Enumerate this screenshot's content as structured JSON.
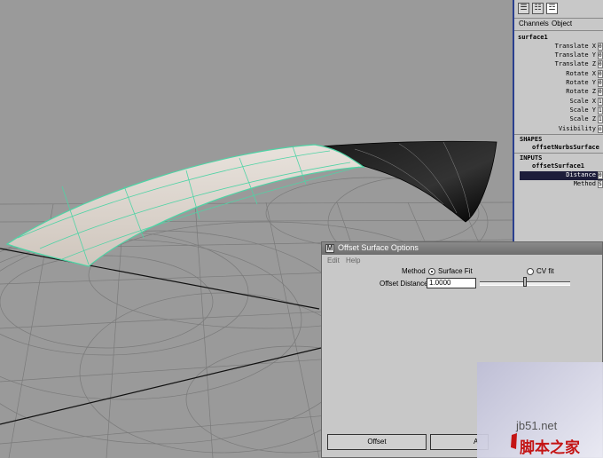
{
  "channel_box": {
    "tabs": [
      "Channels",
      "Object"
    ],
    "node_name": "surface1",
    "attributes": [
      {
        "name": "Translate X",
        "value": "0"
      },
      {
        "name": "Translate Y",
        "value": "0"
      },
      {
        "name": "Translate Z",
        "value": "0"
      },
      {
        "name": "Rotate X",
        "value": "0"
      },
      {
        "name": "Rotate Y",
        "value": "0"
      },
      {
        "name": "Rotate Z",
        "value": "0"
      },
      {
        "name": "Scale X",
        "value": "1"
      },
      {
        "name": "Scale Y",
        "value": "1"
      },
      {
        "name": "Scale Z",
        "value": "1"
      },
      {
        "name": "Visibility",
        "value": "on"
      }
    ],
    "shapes_label": "SHAPES",
    "shape_name": "offsetNurbsSurface",
    "inputs_label": "INPUTS",
    "input_name": "offsetSurface1",
    "input_attrs": [
      {
        "name": "Distance",
        "value": "0",
        "selected": true
      },
      {
        "name": "Method",
        "value": "S",
        "selected": false
      }
    ]
  },
  "dialog": {
    "title": "Offset Surface Options",
    "menu": [
      "Edit",
      "Help"
    ],
    "method_label": "Method",
    "method_options": [
      {
        "label": "Surface Fit",
        "selected": true
      },
      {
        "label": "CV fit",
        "selected": false
      }
    ],
    "offset_distance_label": "Offset Distance",
    "offset_distance_value": "1.0000",
    "slider_value": 0.5,
    "buttons": {
      "offset": "Offset",
      "apply": "A"
    }
  },
  "watermark": {
    "url": "jb51.net",
    "text": "脚本之家"
  },
  "colors": {
    "selected_row": "#1d1d3a",
    "panel_border": "#2a3f8f",
    "wireframe_highlight": "#4fd3a5"
  }
}
